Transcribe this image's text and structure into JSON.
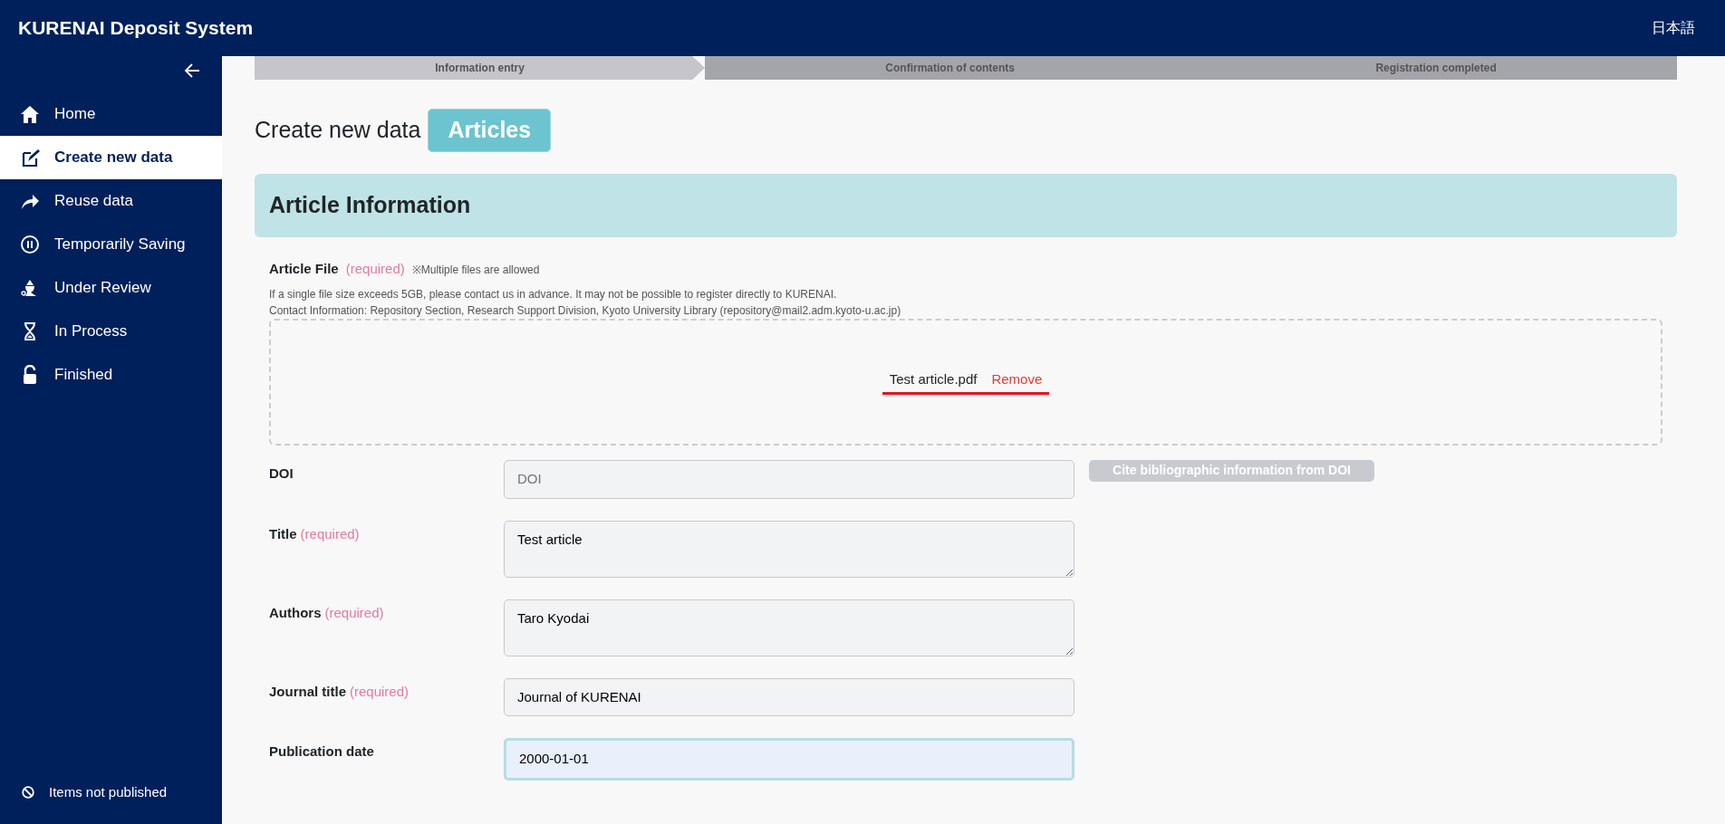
{
  "header": {
    "title": "KURENAI Deposit System",
    "language": "日本語"
  },
  "sidebar": {
    "items": [
      {
        "label": "Home",
        "selected": false
      },
      {
        "label": "Create new data",
        "selected": true
      },
      {
        "label": "Reuse data",
        "selected": false
      },
      {
        "label": "Temporarily Saving",
        "selected": false
      },
      {
        "label": "Under Review",
        "selected": false
      },
      {
        "label": "In Process",
        "selected": false
      },
      {
        "label": "Finished",
        "selected": false
      }
    ],
    "footer": "Items not published"
  },
  "steps": [
    {
      "label": "Information entry",
      "selected": true
    },
    {
      "label": "Confirmation of contents",
      "selected": false
    },
    {
      "label": "Registration completed",
      "selected": false
    }
  ],
  "page_title": "Create new data",
  "type_badge": "Articles",
  "section": {
    "title": "Article Information",
    "article_file": {
      "label": "Article File",
      "required": "(required)",
      "note": "※Multiple files are allowed",
      "info": [
        "If a single file size exceeds 5GB, please contact us in advance. It may not be possible to register directly to KURENAI.",
        "Contact Information: Repository Section, Research Support Division, Kyoto University Library (repository@mail2.adm.kyoto-u.ac.jp)"
      ],
      "files": [
        {
          "name": "Test article.pdf",
          "remove": "Remove"
        }
      ]
    },
    "fields": [
      {
        "kind": "input",
        "label": "DOI",
        "placeholder": "DOI",
        "focused": false,
        "button": {
          "label": "Cite bibliographic information from DOI",
          "disabled": true
        }
      },
      {
        "kind": "textarea",
        "label": "Title",
        "required": "(required)",
        "value": "Test article",
        "focused": false
      },
      {
        "kind": "textarea",
        "label": "Authors",
        "required": "(required)",
        "value": "Taro Kyodai",
        "focused": false
      },
      {
        "kind": "input",
        "label": "Journal title",
        "required": "(required)",
        "value": "Journal of KURENAI",
        "focused": false
      },
      {
        "kind": "input",
        "label": "Publication date",
        "value": "2000-01-01",
        "focused": true
      }
    ]
  }
}
